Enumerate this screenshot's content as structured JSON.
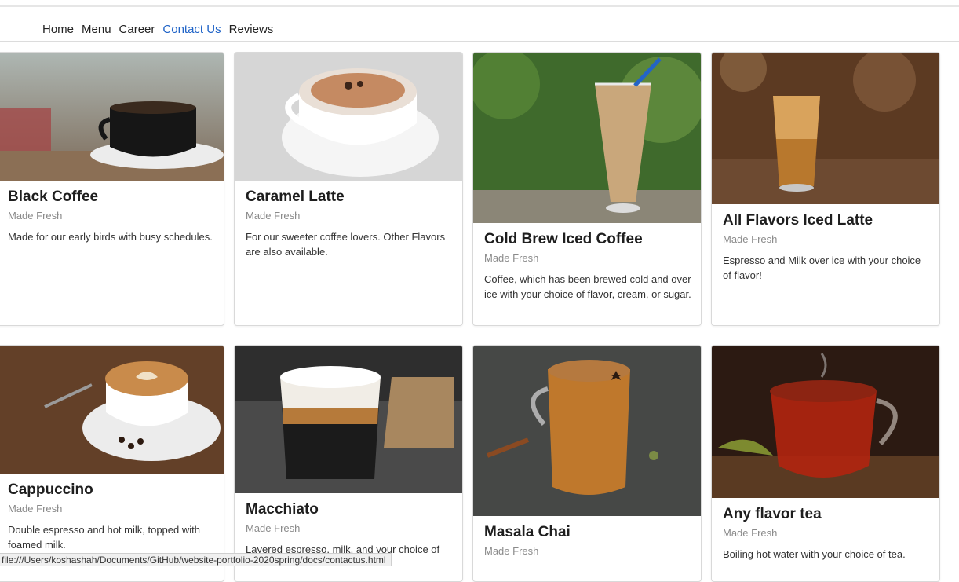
{
  "nav": {
    "items": [
      {
        "label": "Home"
      },
      {
        "label": "Menu"
      },
      {
        "label": "Career"
      },
      {
        "label": "Contact Us"
      },
      {
        "label": "Reviews"
      }
    ]
  },
  "cards": [
    {
      "title": "Black Coffee",
      "subtitle": "Made Fresh",
      "text": "Made for our early birds with busy schedules."
    },
    {
      "title": "Caramel Latte",
      "subtitle": "Made Fresh",
      "text": "For our sweeter coffee lovers. Other Flavors are also available."
    },
    {
      "title": "Cold Brew Iced Coffee",
      "subtitle": "Made Fresh",
      "text": "Coffee, which has been brewed cold and over ice with your choice of flavor, cream, or sugar."
    },
    {
      "title": "All Flavors Iced Latte",
      "subtitle": "Made Fresh",
      "text": "Espresso and Milk over ice with your choice of flavor!"
    },
    {
      "title": "Cappuccino",
      "subtitle": "Made Fresh",
      "text": "Double espresso and hot milk, topped with foamed milk."
    },
    {
      "title": "Macchiato",
      "subtitle": "Made Fresh",
      "text": "Layered espresso, milk, and your choice of"
    },
    {
      "title": "Masala Chai",
      "subtitle": "Made Fresh",
      "text": ""
    },
    {
      "title": "Any flavor tea",
      "subtitle": "Made Fresh",
      "text": "Boiling hot water with your choice of tea."
    }
  ],
  "status": {
    "url": "file:///Users/koshashah/Documents/GitHub/website-portfolio-2020spring/docs/contactus.html"
  },
  "colors": {
    "active_nav": "#1f63c7",
    "card_border": "#d9d9d9",
    "subtitle": "#8a8a8a"
  }
}
